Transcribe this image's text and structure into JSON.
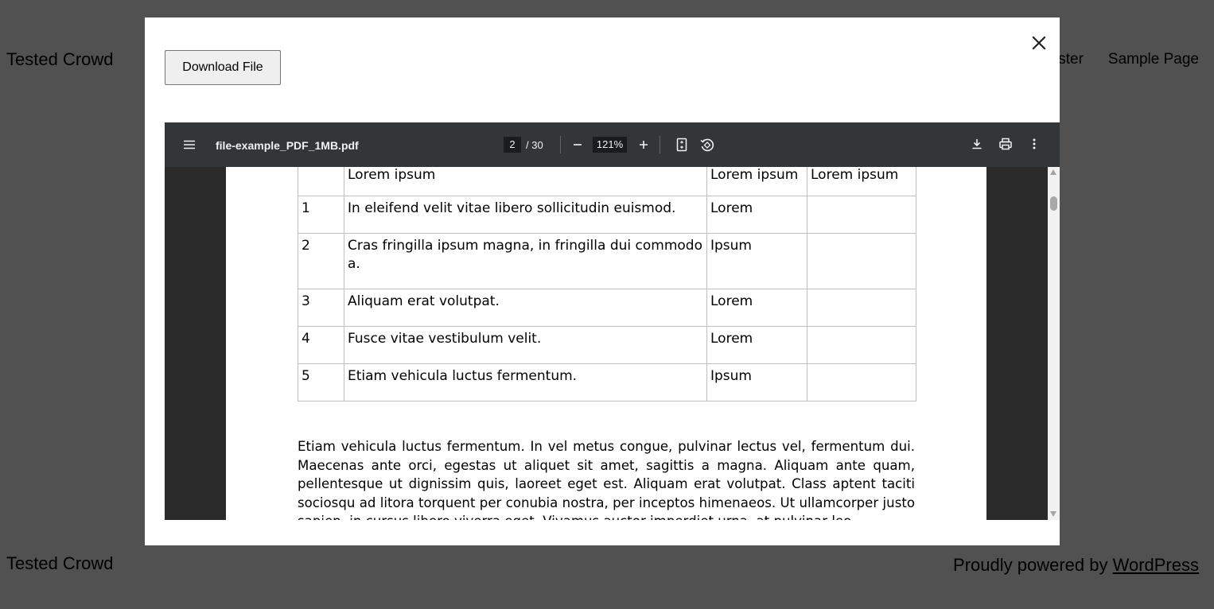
{
  "site": {
    "title": "Tested Crowd",
    "nav": [
      "ster",
      "Sample Page"
    ],
    "footer_title": "Tested Crowd",
    "footer_credit_prefix": "Proudly powered by ",
    "footer_credit_link": "WordPress"
  },
  "modal": {
    "download_label": "Download File",
    "close_icon": "close-icon"
  },
  "viewer": {
    "file_name": "file-example_PDF_1MB.pdf",
    "current_page": "2",
    "total_pages": "/ 30",
    "zoom": "121%",
    "icons": [
      "menu-icon",
      "zoom-out-icon",
      "zoom-in-icon",
      "fit-page-icon",
      "rotate-icon",
      "download-icon",
      "print-icon",
      "more-icon"
    ]
  },
  "document": {
    "table": {
      "rows": [
        [
          "",
          "Lorem ipsum",
          "Lorem ipsum",
          "Lorem ipsum"
        ],
        [
          "1",
          "In eleifend velit vitae libero sollicitudin euismod.",
          "Lorem",
          ""
        ],
        [
          "2",
          "Cras fringilla ipsum magna, in fringilla dui commodo a.",
          "Ipsum",
          ""
        ],
        [
          "3",
          "Aliquam erat volutpat.",
          "Lorem",
          ""
        ],
        [
          "4",
          "Fusce vitae vestibulum velit.",
          "Lorem",
          ""
        ],
        [
          "5",
          "Etiam vehicula luctus fermentum.",
          "Ipsum",
          ""
        ]
      ]
    },
    "paragraph": "Etiam vehicula luctus fermentum. In vel metus congue, pulvinar lectus vel, fermentum dui. Maecenas ante orci, egestas ut aliquet sit amet, sagittis a magna. Aliquam ante quam, pellentesque ut dignissim quis, laoreet eget est. Aliquam erat volutpat. Class aptent taciti sociosqu ad litora torquent per conubia nostra, per inceptos himenaeos. Ut ullamcorper justo sapien, in cursus libero viverra eget. Vivamus auctor imperdiet urna, at pulvinar leo"
  }
}
